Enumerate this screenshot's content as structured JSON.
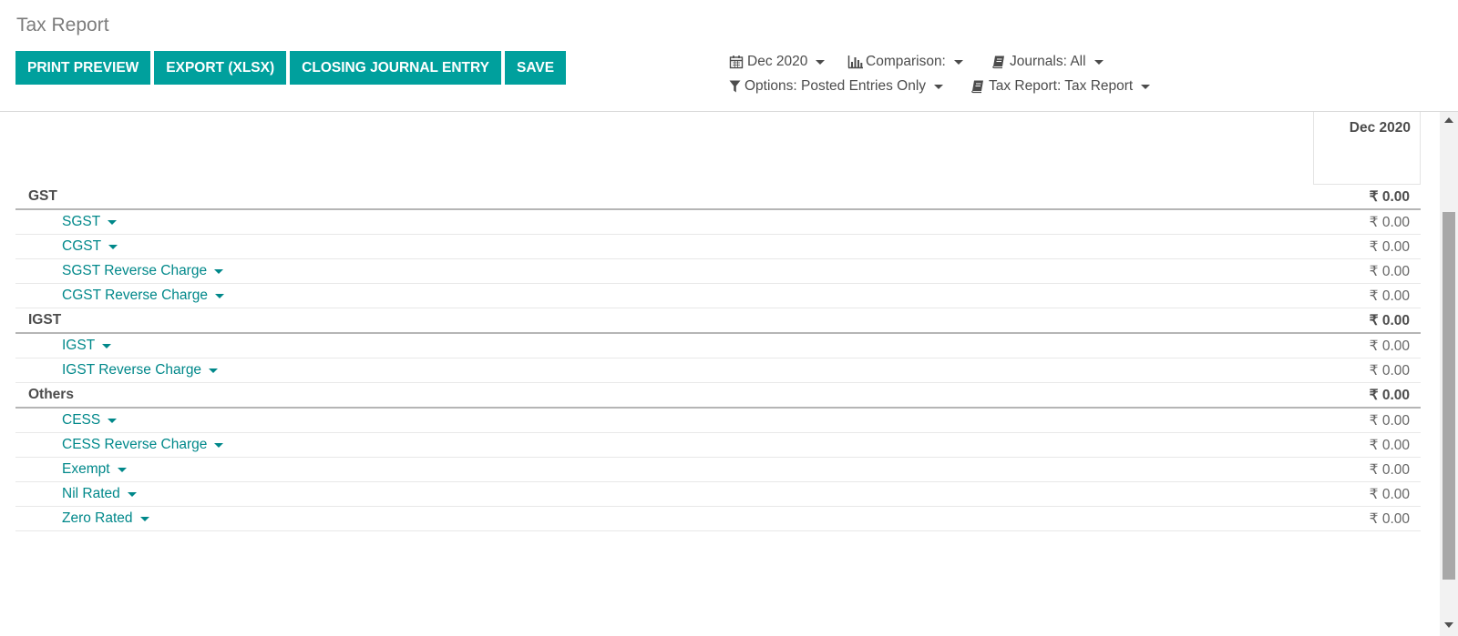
{
  "page_title": "Tax Report",
  "buttons": {
    "print_preview": "PRINT PREVIEW",
    "export_xlsx": "EXPORT (XLSX)",
    "closing_journal_entry": "CLOSING JOURNAL ENTRY",
    "save": "SAVE"
  },
  "filters": {
    "date": "Dec 2020",
    "comparison": "Comparison:",
    "journals": "Journals: All",
    "options": "Options: Posted Entries Only",
    "tax_report": "Tax Report: Tax Report"
  },
  "icons": {
    "date": "calendar-icon",
    "comparison": "bar-chart-icon",
    "journals": "book-icon",
    "options": "filter-icon",
    "tax_report": "book-icon"
  },
  "colors": {
    "accent": "#00a09d",
    "link": "#00888a"
  },
  "report": {
    "column_header": "Dec 2020",
    "sections": [
      {
        "label": "GST",
        "amount": "₹ 0.00",
        "lines": [
          {
            "label": "SGST",
            "amount": "₹ 0.00"
          },
          {
            "label": "CGST",
            "amount": "₹ 0.00"
          },
          {
            "label": "SGST Reverse Charge",
            "amount": "₹ 0.00"
          },
          {
            "label": "CGST Reverse Charge",
            "amount": "₹ 0.00"
          }
        ]
      },
      {
        "label": "IGST",
        "amount": "₹ 0.00",
        "lines": [
          {
            "label": "IGST",
            "amount": "₹ 0.00"
          },
          {
            "label": "IGST Reverse Charge",
            "amount": "₹ 0.00"
          }
        ]
      },
      {
        "label": "Others",
        "amount": "₹ 0.00",
        "lines": [
          {
            "label": "CESS",
            "amount": "₹ 0.00"
          },
          {
            "label": "CESS Reverse Charge",
            "amount": "₹ 0.00"
          },
          {
            "label": "Exempt",
            "amount": "₹ 0.00"
          },
          {
            "label": "Nil Rated",
            "amount": "₹ 0.00"
          },
          {
            "label": "Zero Rated",
            "amount": "₹ 0.00"
          }
        ]
      }
    ]
  }
}
